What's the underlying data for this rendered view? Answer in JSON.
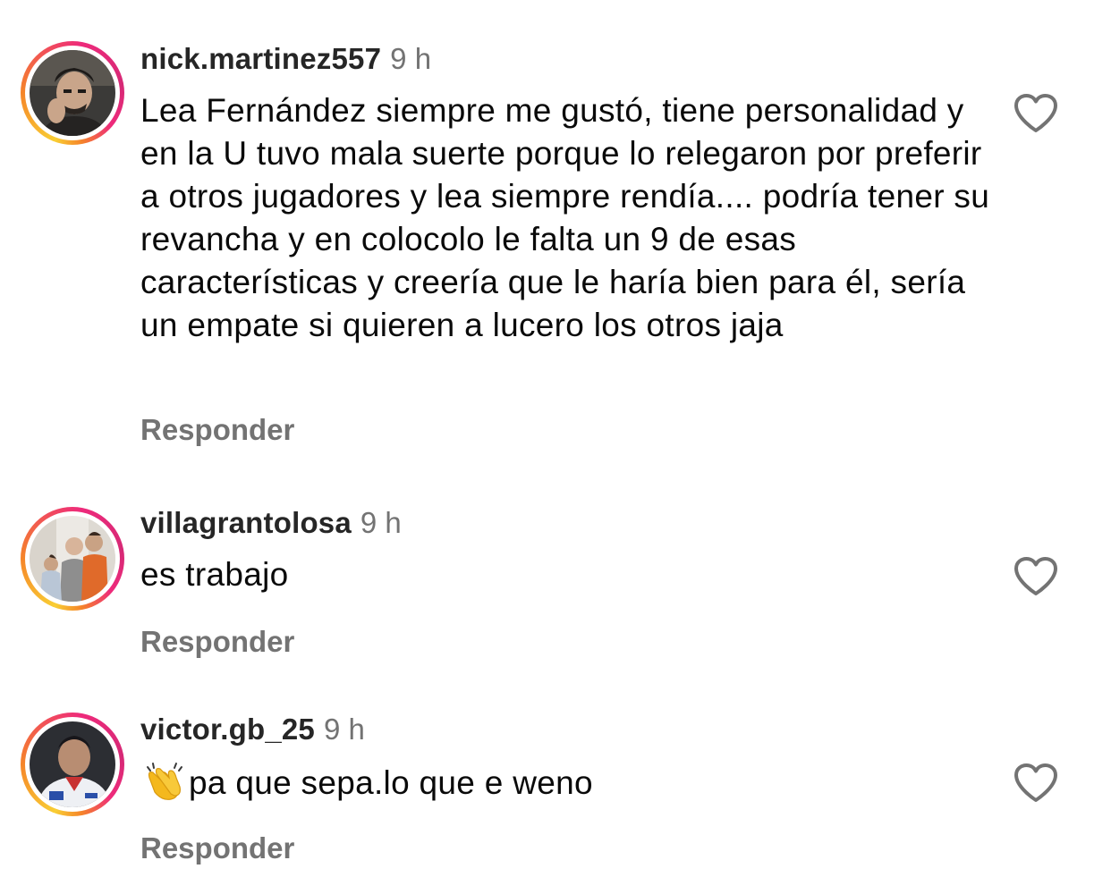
{
  "comments": [
    {
      "username": "nick.martinez557",
      "time": "9 h",
      "text": "Lea Fernández siempre me gustó, tiene personalidad y en la U tuvo mala suerte porque lo relegaron por preferir a otros jugadores y lea siempre rendía.... podría tener su revancha y en colocolo le falta un 9 de esas características y creería que le haría bien para él, sería un empate si quieren a lucero los otros jaja",
      "reply_label": "Responder",
      "like_icon": "heart-outline-icon"
    },
    {
      "username": "villagrantolosa",
      "time": "9 h",
      "text": "es trabajo",
      "reply_label": "Responder",
      "like_icon": "heart-outline-icon"
    },
    {
      "username": "victor.gb_25",
      "time": "9 h",
      "emoji": "clapping-hands",
      "text": "pa que sepa.lo que e weno",
      "reply_label": "Responder",
      "like_icon": "heart-outline-icon"
    }
  ],
  "colors": {
    "username": "#262626",
    "meta_gray": "#737373",
    "story_ring": [
      "#f9ce34",
      "#ee2a7b",
      "#6228d7"
    ]
  }
}
